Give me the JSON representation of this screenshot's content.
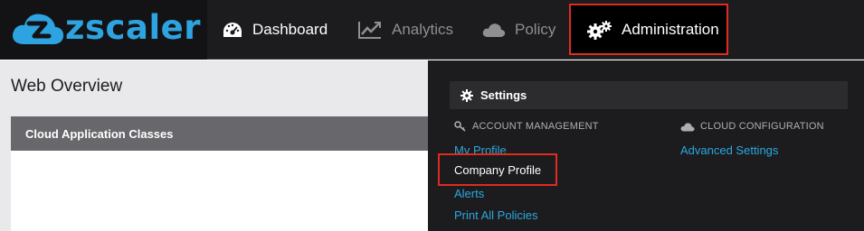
{
  "brand": {
    "name": "zscaler",
    "color": "#2da3e0"
  },
  "nav": {
    "dashboard": "Dashboard",
    "analytics": "Analytics",
    "policy": "Policy",
    "administration": "Administration"
  },
  "main": {
    "title": "Web Overview",
    "card_title": "Cloud Application Classes"
  },
  "admin_menu": {
    "settings_label": "Settings",
    "account_management": {
      "heading": "ACCOUNT MANAGEMENT",
      "items": [
        "My Profile",
        "Company Profile",
        "Alerts",
        "Print All Policies"
      ]
    },
    "cloud_configuration": {
      "heading": "CLOUD CONFIGURATION",
      "items": [
        "Advanced Settings"
      ]
    }
  },
  "colors": {
    "highlight": "#e02b20",
    "link": "#2aa8e0"
  },
  "icons": [
    "zscaler-cloud-icon",
    "speedometer-icon",
    "chart-line-icon",
    "cloud-icon",
    "gears-icon",
    "gear-icon",
    "key-icon",
    "cloud-small-icon"
  ]
}
